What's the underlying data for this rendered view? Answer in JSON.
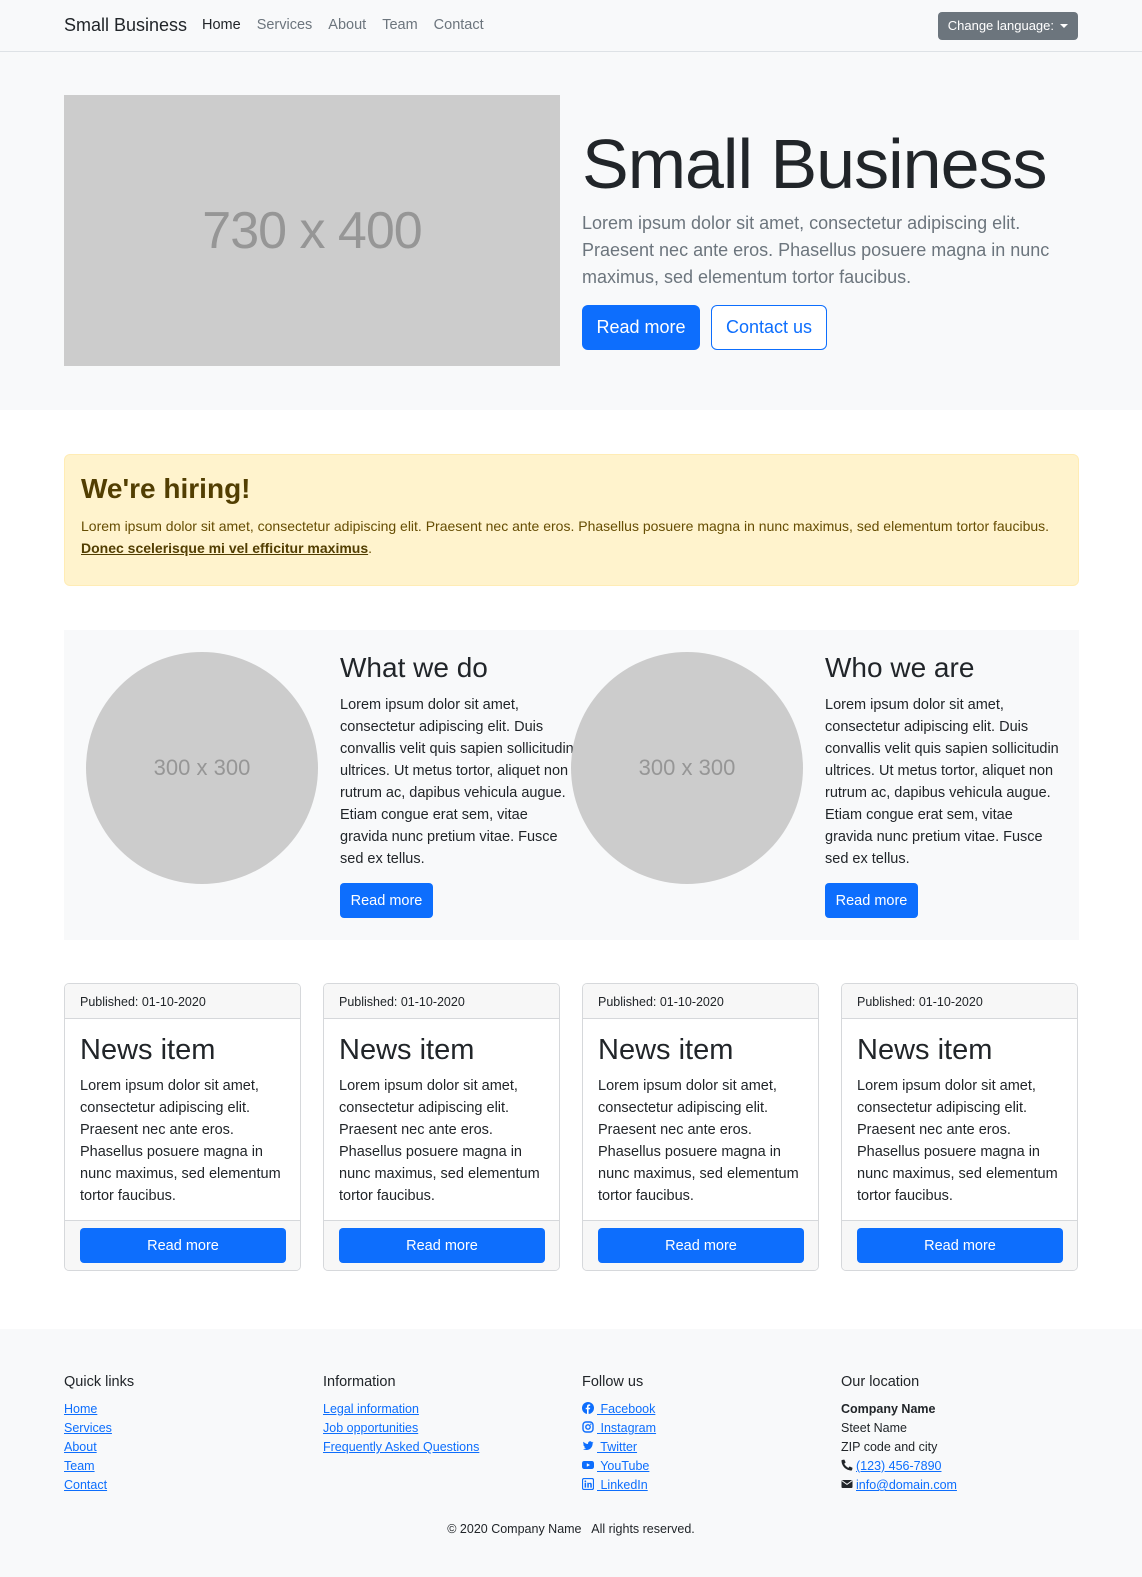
{
  "navbar": {
    "brand": "Small Business",
    "links": [
      "Home",
      "Services",
      "About",
      "Team",
      "Contact"
    ],
    "language_button": "Change language:"
  },
  "hero": {
    "image_placeholder": "730 x 400",
    "title": "Small Business",
    "text": "Lorem ipsum dolor sit amet, consectetur adipiscing elit. Praesent nec ante eros. Phasellus posuere magna in nunc maximus, sed elementum tortor faucibus.",
    "primary_button": "Read more",
    "secondary_button": "Contact us"
  },
  "alert": {
    "title": "We're hiring!",
    "text": "Lorem ipsum dolor sit amet, consectetur adipiscing elit. Praesent nec ante eros. Phasellus posuere magna in nunc maximus, sed elementum tortor faucibus. ",
    "link": "Donec scelerisque mi vel efficitur maximus",
    "suffix": "."
  },
  "features": [
    {
      "image_placeholder": "300 x 300",
      "title": "What we do",
      "text": "Lorem ipsum dolor sit amet, consectetur adipiscing elit. Duis convallis velit quis sapien sollicitudin ultrices. Ut metus tortor, aliquet non rutrum ac, dapibus vehicula augue. Etiam congue erat sem, vitae gravida nunc pretium vitae. Fusce sed ex tellus.",
      "button": "Read more"
    },
    {
      "image_placeholder": "300 x 300",
      "title": "Who we are",
      "text": "Lorem ipsum dolor sit amet, consectetur adipiscing elit. Duis convallis velit quis sapien sollicitudin ultrices. Ut metus tortor, aliquet non rutrum ac, dapibus vehicula augue. Etiam congue erat sem, vitae gravida nunc pretium vitae. Fusce sed ex tellus.",
      "button": "Read more"
    }
  ],
  "news": [
    {
      "published": "Published: 01-10-2020",
      "title": "News item",
      "text": "Lorem ipsum dolor sit amet, consectetur adipiscing elit. Praesent nec ante eros. Phasellus posuere magna in nunc maximus, sed elementum tortor faucibus.",
      "button": "Read more"
    },
    {
      "published": "Published: 01-10-2020",
      "title": "News item",
      "text": "Lorem ipsum dolor sit amet, consectetur adipiscing elit. Praesent nec ante eros. Phasellus posuere magna in nunc maximus, sed elementum tortor faucibus.",
      "button": "Read more"
    },
    {
      "published": "Published: 01-10-2020",
      "title": "News item",
      "text": "Lorem ipsum dolor sit amet, consectetur adipiscing elit. Praesent nec ante eros. Phasellus posuere magna in nunc maximus, sed elementum tortor faucibus.",
      "button": "Read more"
    },
    {
      "published": "Published: 01-10-2020",
      "title": "News item",
      "text": "Lorem ipsum dolor sit amet, consectetur adipiscing elit. Praesent nec ante eros. Phasellus posuere magna in nunc maximus, sed elementum tortor faucibus.",
      "button": "Read more"
    }
  ],
  "footer": {
    "quick_links": {
      "title": "Quick links",
      "links": [
        "Home",
        "Services",
        "About",
        "Team",
        "Contact"
      ]
    },
    "information": {
      "title": "Information",
      "links": [
        "Legal information",
        "Job opportunities",
        "Frequently Asked Questions"
      ]
    },
    "follow_us": {
      "title": "Follow us",
      "links": [
        {
          "label": " Facebook",
          "icon": "facebook-icon"
        },
        {
          "label": " Instagram",
          "icon": "instagram-icon"
        },
        {
          "label": " Twitter",
          "icon": "twitter-icon"
        },
        {
          "label": " YouTube",
          "icon": "youtube-icon"
        },
        {
          "label": " LinkedIn",
          "icon": "linkedin-icon"
        }
      ]
    },
    "location": {
      "title": "Our location",
      "company": "Company Name",
      "street": "Steet Name",
      "zip": "ZIP code and city",
      "phone": "(123) 456-7890",
      "email": "info@domain.com"
    },
    "copyright": "© 2020 Company Name   All rights reserved."
  },
  "colors": {
    "primary": "#0d6efd",
    "alert_bg": "#fff3cd",
    "placeholder": "#cccccc",
    "light_bg": "#f8f9fa"
  }
}
